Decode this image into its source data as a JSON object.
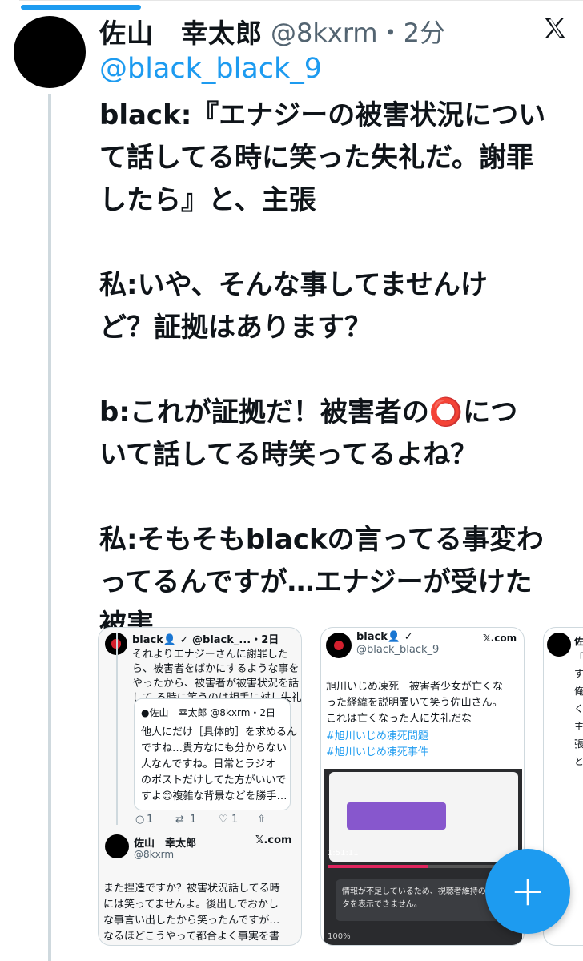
{
  "post": {
    "display_name": "佐山　幸太郎",
    "handle_time": "@8kxrm・2分",
    "mention": "@black_black_9",
    "body": "black:『エナジーの被害状況につい\nて話してる時に笑った失礼だ。謝罪\nしたら』と、主張\n\n私:いや、そんな事してませんけ\nど？証拠はあります？\n\nb:これが証拠だ！被害者の⭕️につ\nいて話してる時笑ってるよね？\n\n私:そもそもblackの言ってる事変わ\nってるんですが…エナジーが受けた\n被害"
  },
  "card1": {
    "header": "black👤 ✓ @black_...・2日",
    "reply_lines": [
      "それよりエナジーさんに謝罪した",
      "ら、被害者をばかにするような事を",
      "やったから、被害者が被害状況を話",
      "して る時に笑うのは相手に対し失礼"
    ],
    "quote_header": "●佐山　幸太郎 @8kxrm・2日",
    "quote_lines": [
      "他人にだけ［具体的］を求めるん",
      "ですね…貴方なにも分からない",
      "人なんですね。日常とラジオ",
      "のポストだけしてた方がいいで",
      "すよ😊複雑な背景などを勝手…"
    ],
    "actions": [
      "1",
      "1",
      "1"
    ],
    "author_name": "佐山　幸太郎",
    "author_handle": "@8kxrm",
    "site": "𝕏.com",
    "bottom_lines": [
      "また捏造ですか？被害状況話してる時",
      "には笑ってませんよ。後出しでおかし",
      "な事言い出したから笑ったんですが…",
      "なるほどこうやって都合よく事実を書"
    ]
  },
  "card2": {
    "name": "black👤 ✓",
    "handle": "@black_black_9",
    "site": "𝕏.com",
    "lines": [
      "旭川いじめ凍死　被害者少女が亡くな",
      "った経緯を説明聞いて笑う佐山さん。",
      "これは亡くなった人に失礼だな"
    ],
    "hashtags": [
      "#旭川いじめ凍死問題",
      "#旭川いじめ凍死事件"
    ],
    "video_time": "1:51:11",
    "notice": "情報が不足しているため、視聴者維持のデ ータを表示できません。",
    "zoom": "100%"
  },
  "card3": {
    "lines": [
      "佐",
      "「",
      "す",
      "俺",
      "く",
      "主",
      "張",
      "と"
    ]
  },
  "icons": {
    "close": "x-logo-icon",
    "compose": "plus-icon"
  },
  "colors": {
    "accent": "#1d9bf0",
    "text": "#0f1419",
    "muted": "#536471"
  }
}
